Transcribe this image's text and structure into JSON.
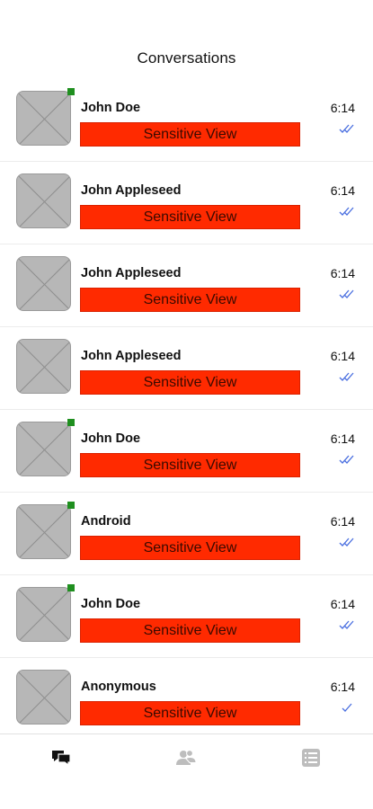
{
  "header": {
    "title": "Conversations"
  },
  "conversations": [
    {
      "name": "John Doe",
      "time": "6:14",
      "preview": "Sensitive View",
      "online": true,
      "status": "read"
    },
    {
      "name": "John Appleseed",
      "time": "6:14",
      "preview": "Sensitive View",
      "online": false,
      "status": "read"
    },
    {
      "name": "John Appleseed",
      "time": "6:14",
      "preview": "Sensitive View",
      "online": false,
      "status": "read"
    },
    {
      "name": "John Appleseed",
      "time": "6:14",
      "preview": "Sensitive View",
      "online": false,
      "status": "read"
    },
    {
      "name": "John Doe",
      "time": "6:14",
      "preview": "Sensitive View",
      "online": true,
      "status": "read"
    },
    {
      "name": "Android",
      "time": "6:14",
      "preview": "Sensitive View",
      "online": true,
      "status": "read"
    },
    {
      "name": "John Doe",
      "time": "6:14",
      "preview": "Sensitive View",
      "online": true,
      "status": "read"
    },
    {
      "name": "Anonymous",
      "time": "6:14",
      "preview": "Sensitive View",
      "online": false,
      "status": "sent"
    }
  ],
  "tabs": [
    {
      "icon": "chat-bubbles-icon",
      "active": true
    },
    {
      "icon": "contacts-icon",
      "active": false
    },
    {
      "icon": "list-icon",
      "active": false
    }
  ],
  "colors": {
    "sensitive_bg": "#ff2a00",
    "online": "#1f8f1f",
    "tick": "#4a6fe0",
    "tab_active": "#111111",
    "tab_inactive": "#bdbdbd"
  }
}
